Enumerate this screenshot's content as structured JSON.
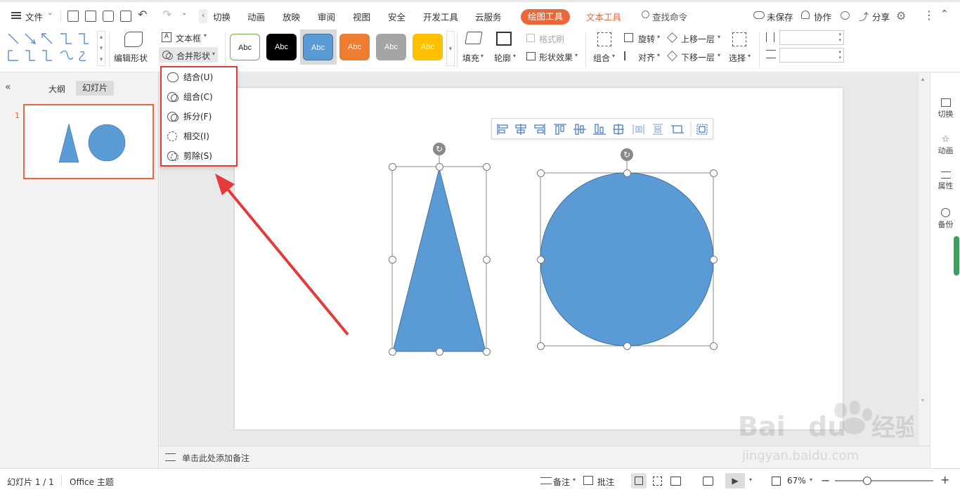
{
  "menu": {
    "file": "文件",
    "tabs": [
      "切换",
      "动画",
      "放映",
      "审阅",
      "视图",
      "安全",
      "开发工具",
      "云服务"
    ],
    "active_tab": "绘图工具",
    "text_tools": "文本工具",
    "search": "查找命令",
    "unsaved": "未保存",
    "collab": "协作",
    "share": "分享"
  },
  "ribbon": {
    "edit_shape": "编辑形状",
    "textbox": "文本框",
    "merge_shape": "合并形状",
    "style_label": "Abc",
    "fill": "填充",
    "outline": "轮廓",
    "format_painter": "格式刷",
    "shape_effects": "形状效果",
    "group": "组合",
    "rotate": "旋转",
    "align": "对齐",
    "bring_forward": "上移一层",
    "send_backward": "下移一层",
    "select": "选择"
  },
  "dropdown": {
    "items": [
      "结合(U)",
      "组合(C)",
      "拆分(F)",
      "相交(I)",
      "剪除(S)"
    ]
  },
  "leftpane": {
    "tab_outline": "大纲",
    "tab_slides": "幻灯片",
    "slide_number": "1"
  },
  "notes": {
    "placeholder": "单击此处添加备注"
  },
  "rightpanel": {
    "items": [
      "切换",
      "动画",
      "属性",
      "备份"
    ]
  },
  "statusbar": {
    "slide_info": "幻灯片 1 / 1",
    "theme": "Office 主题",
    "notes": "备注",
    "comments": "批注",
    "zoom": "67%"
  },
  "colors": {
    "accent": "#e8683a",
    "shape_fill": "#5b9bd5",
    "highlight_red": "#e53a3a",
    "style_white": "#ffffff",
    "style_black": "#000000",
    "style_blue": "#5b9bd5",
    "style_orange": "#ed7d31",
    "style_gray": "#a5a5a5",
    "style_yellow": "#ffc000"
  }
}
